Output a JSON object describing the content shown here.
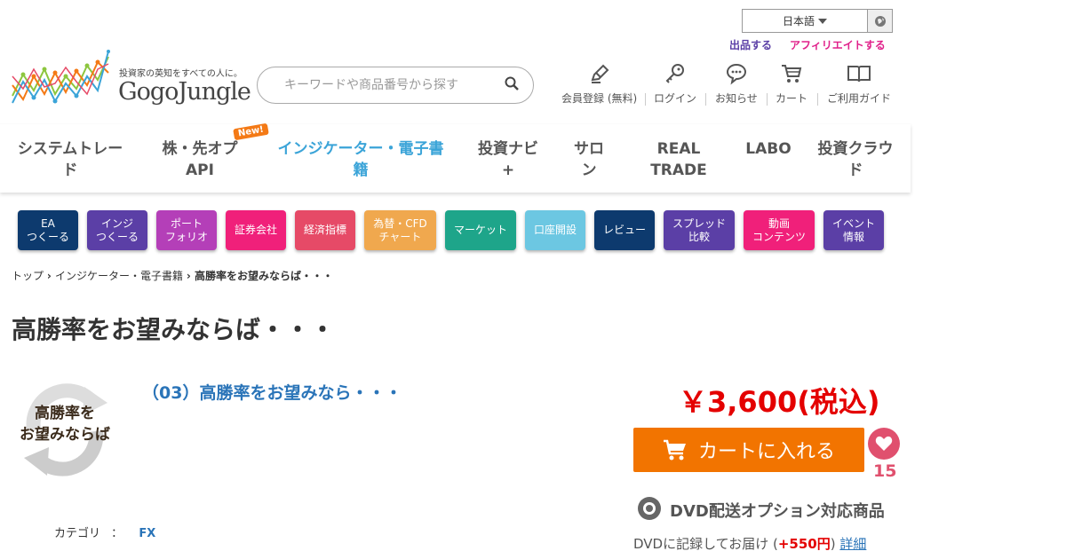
{
  "header": {
    "language": "日本語",
    "sell_link": "出品する",
    "affiliate_link": "アフィリエイトする",
    "tagline": "投資家の英知をすべての人に。",
    "logo_text": "GogoJungle",
    "search_placeholder": "キーワードや商品番号から探す",
    "icon_nav": [
      "会員登録 (無料)",
      "ログイン",
      "お知らせ",
      "カート",
      "ご利用ガイド"
    ]
  },
  "main_nav": {
    "items": [
      {
        "line1": "システムトレー",
        "line2": "ド"
      },
      {
        "line1": "株・先オプ",
        "line2": "API"
      },
      {
        "line1": "インジケーター・電子書",
        "line2": "籍"
      },
      {
        "line1": "投資ナビ",
        "line2": "+"
      },
      {
        "line1": "サロ",
        "line2": "ン"
      },
      {
        "line1": "REAL",
        "line2": "TRADE"
      },
      {
        "line1": "LABO",
        "line2": ""
      },
      {
        "line1": "投資クラウ",
        "line2": "ド"
      }
    ],
    "new_badge": "New!",
    "active_color": "#3ba4d8"
  },
  "categories": [
    {
      "line1": "EA",
      "line2": "つくーる",
      "color": "#0d3a6e"
    },
    {
      "line1": "インジ",
      "line2": "つくーる",
      "color": "#5b3fa6"
    },
    {
      "line1": "ポート",
      "line2": "フォリオ",
      "color": "#b43fb8"
    },
    {
      "line1": "証券会社",
      "line2": "",
      "color": "#f0207a"
    },
    {
      "line1": "経済指標",
      "line2": "",
      "color": "#e64a67"
    },
    {
      "line1": "為替・CFD",
      "line2": "チャート",
      "color": "#f0a84e"
    },
    {
      "line1": "マーケット",
      "line2": "",
      "color": "#1ea58a"
    },
    {
      "line1": "口座開設",
      "line2": "",
      "color": "#6cc7e2"
    },
    {
      "line1": "レビュー",
      "line2": "",
      "color": "#0d3a6e"
    },
    {
      "line1": "スプレッド",
      "line2": "比較",
      "color": "#5b3fa6"
    },
    {
      "line1": "動画",
      "line2": "コンテンツ",
      "color": "#f0207a"
    },
    {
      "line1": "イベント",
      "line2": "情報",
      "color": "#5b3fa6"
    }
  ],
  "breadcrumb": {
    "home": "トップ",
    "category": "インジケーター・電子書籍",
    "current": "高勝率をお望みならば・・・"
  },
  "product": {
    "title": "高勝率をお望みならば・・・",
    "thumb_line1": "高勝率を",
    "thumb_line2": "お望みならば",
    "link_title": "（03）高勝率をお望みなら・・・",
    "price": "￥3,600(税込)",
    "cart_label": "カートに入れる",
    "fav_count": "15",
    "dvd_title": "DVD配送オプション対応商品",
    "dvd_note_prefix": "DVDに記録してお届け (",
    "dvd_price": "+550円",
    "dvd_note_suffix": ")",
    "dvd_detail": "詳細",
    "category_label": "カテゴリ",
    "category_sep": "：",
    "category_value": "FX"
  }
}
